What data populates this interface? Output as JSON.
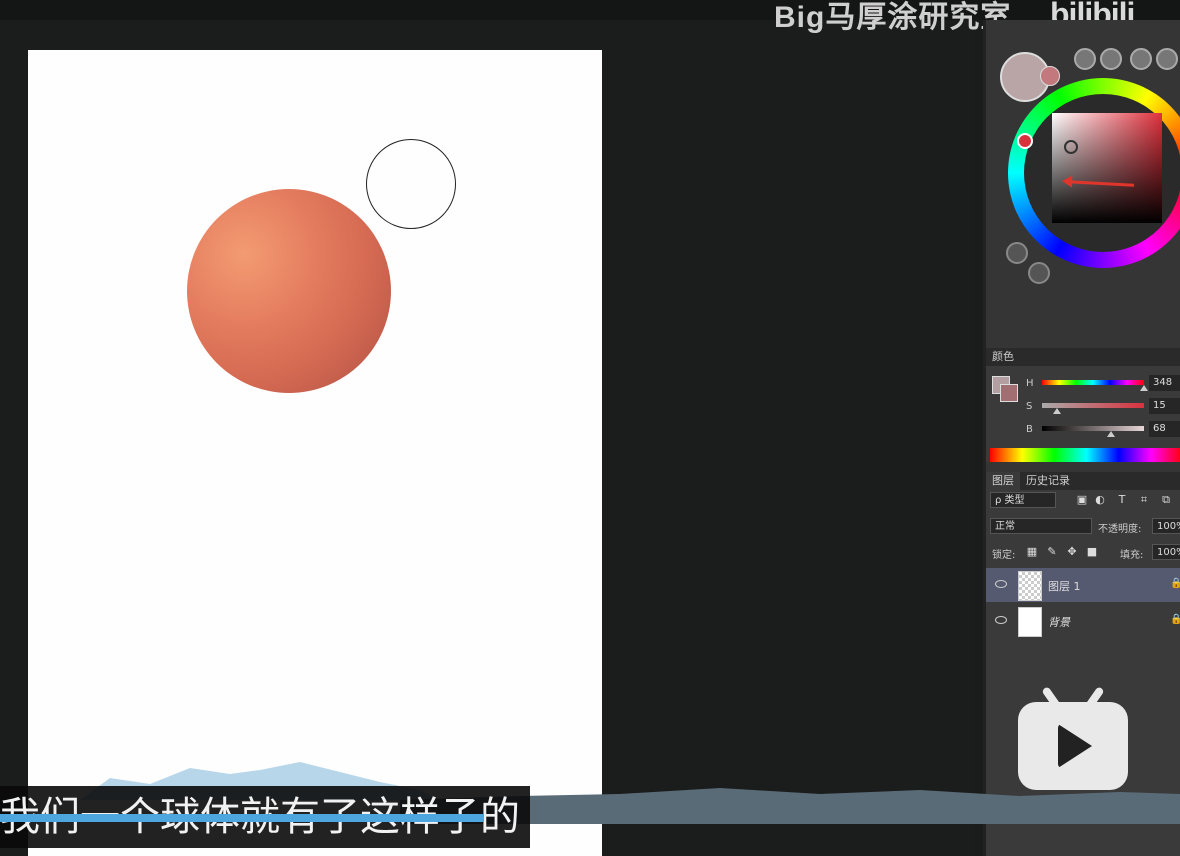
{
  "watermark": {
    "channel": "Big马厚涂研究室",
    "logo": "bilibili"
  },
  "canvas": {
    "ball_color": "#e47d5f",
    "tool": "brush-cursor"
  },
  "color_panel": {
    "tab_label": "颜色",
    "foreground": "#b39fa2",
    "background": "#a16f72",
    "h": {
      "label": "H",
      "value": "348"
    },
    "s": {
      "label": "S",
      "value": "15"
    },
    "b": {
      "label": "B",
      "value": "68"
    }
  },
  "layers_panel": {
    "tabs": [
      "图层",
      "历史记录"
    ],
    "filter_kind": "ρ 类型",
    "filter_icons": [
      "image-icon",
      "adjustment-icon",
      "text-icon",
      "shape-icon",
      "smart-object-icon"
    ],
    "filter_icon_glyphs": [
      "▣",
      "◐",
      "T",
      "⌗",
      "⧉"
    ],
    "blend_mode": "正常",
    "opacity_label": "不透明度:",
    "opacity_value": "100%",
    "lock_label": "锁定:",
    "fill_label": "填充:",
    "fill_value": "100%",
    "layers": [
      {
        "name": "图层 1",
        "selected": true
      },
      {
        "name": "背景",
        "selected": false
      }
    ]
  },
  "subtitle": "我们一个球体就有了这样子的",
  "video_progress": 0.41
}
